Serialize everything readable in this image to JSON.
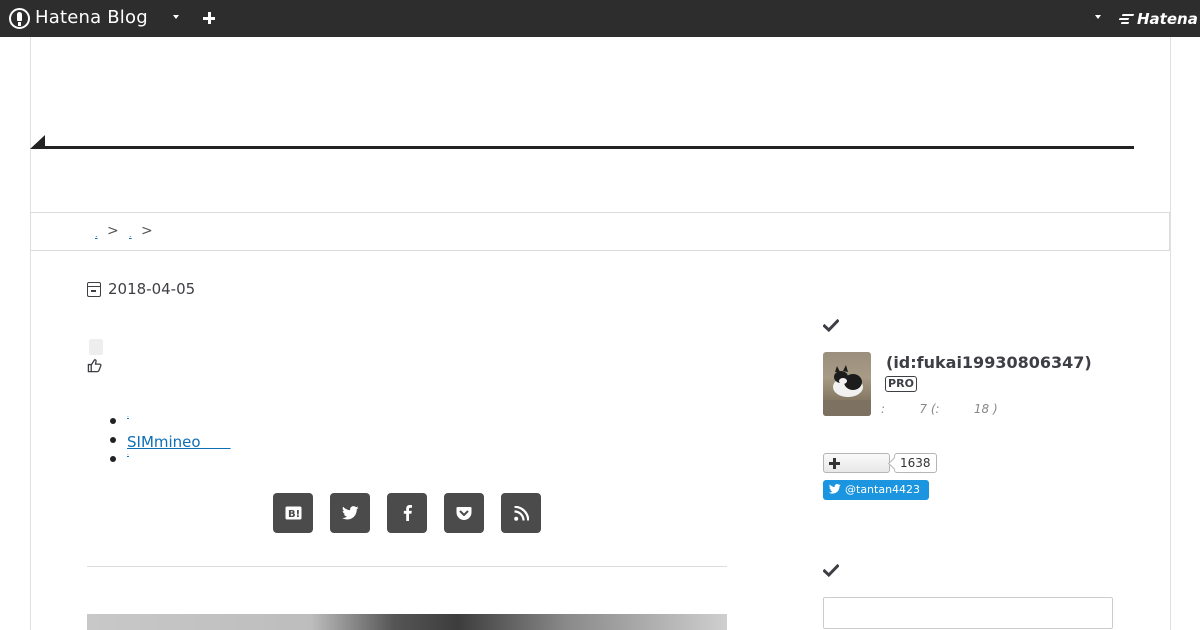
{
  "global_header": {
    "logo_text": "Hatena Blog",
    "brand_text": "Hatena"
  },
  "breadcrumb": {
    "items": [
      ".",
      "."
    ],
    "separator": ">"
  },
  "entry": {
    "date": "2018-04-05",
    "related_links": [
      ".",
      "SIMmineo　　",
      "."
    ],
    "share_buttons": [
      "hatena-bookmark",
      "twitter",
      "facebook",
      "pocket",
      "rss"
    ]
  },
  "sidebar": {
    "profile": {
      "id_text": "(id:fukai19930806347)",
      "badge": "PRO",
      "meta": ":         7 (:         18 )"
    },
    "follow": {
      "count": "1638"
    },
    "twitter_button": "@tantan4423"
  }
}
